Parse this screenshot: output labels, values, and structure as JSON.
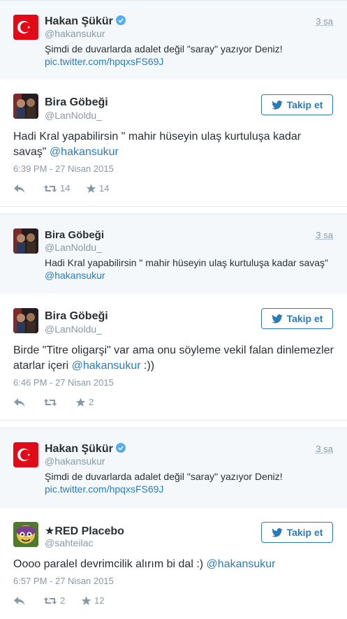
{
  "colors": {
    "link": "#2b7bb9",
    "muted": "#8899a6",
    "quoted_bg": "#f5f8fa",
    "flag_red": "#e30a17"
  },
  "icons": {
    "reply": "reply-icon",
    "retweet": "retweet-icon",
    "favorite": "star-icon",
    "verified": "verified-badge-icon",
    "follow": "twitter-bird-icon"
  },
  "quoted1": {
    "name": "Hakan Şükür",
    "handle": "@hakansukur",
    "time": "3 sa",
    "text": "Şimdi de duvarlarda adalet değil \"saray\" yazıyor Deniz!",
    "link": "pic.twitter.com/hpqxsFS69J"
  },
  "tweet1": {
    "name": "Bira Göbeği",
    "handle": "@LanNoldu_",
    "follow": "Takip et",
    "text_prefix": "Hadi Kral yapabilirsin \" mahir hüseyin ulaş kurtuluşa kadar savaş\"  ",
    "mention": "@hakansukur",
    "stamp": "6:39 PM - 27 Nisan 2015",
    "retweets": "14",
    "favorites": "14"
  },
  "quoted2": {
    "name": "Bira Göbeği",
    "handle": "@LanNoldu_",
    "time": "3 sa",
    "text": "Hadi Kral yapabilirsin \" mahir hüseyin ulaş kurtuluşa kadar savaş\"",
    "link": "@hakansukur"
  },
  "tweet2": {
    "name": "Bira Göbeği",
    "handle": "@LanNoldu_",
    "follow": "Takip et",
    "text_prefix": "Birde \"Titre oligarşi\" var ama onu söyleme vekil falan dinlemezler atarlar içeri ",
    "mention": "@hakansukur",
    "text_suffix": " :))",
    "stamp": "6:46 PM - 27 Nisan 2015",
    "retweets": "",
    "favorites": "2"
  },
  "quoted3": {
    "name": "Hakan Şükür",
    "handle": "@hakansukur",
    "time": "3 sa",
    "text": "Şimdi de duvarlarda adalet değil \"saray\" yazıyor Deniz!",
    "link": "pic.twitter.com/hpqxsFS69J"
  },
  "tweet3": {
    "name": "★RED Placebo",
    "handle": "@sahteilac",
    "follow": "Takip et",
    "text_prefix": "Oooo paralel devrimcilik alırım bi dal :) ",
    "mention": "@hakansukur",
    "stamp": "6:57 PM - 27 Nisan 2015",
    "retweets": "2",
    "favorites": "12"
  }
}
